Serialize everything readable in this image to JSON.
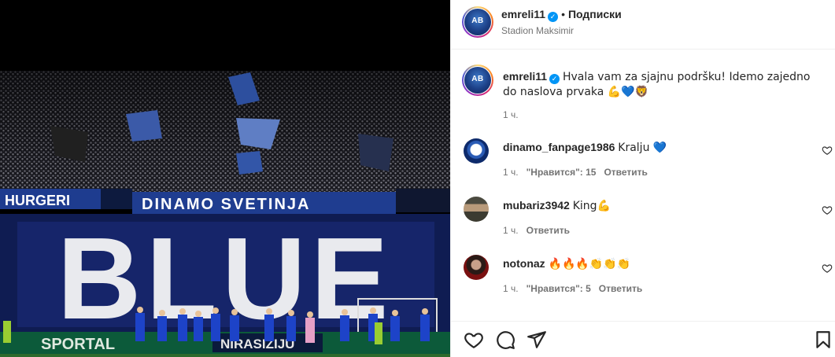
{
  "header": {
    "username": "emreli11",
    "separator": "•",
    "follow_label": "Подписки",
    "location": "Stadion Maksimir",
    "avatar_text": "AB"
  },
  "caption": {
    "username": "emreli11",
    "text": "Hvala vam za sjajnu podršku! Idemo zajedno do naslova prvaka 💪💙🦁",
    "time": "1 ч."
  },
  "comments": [
    {
      "username": "dinamo_fanpage1986",
      "text": "Kralju 💙",
      "time": "1 ч.",
      "likes": "\"Нравится\": 15",
      "reply": "Ответить"
    },
    {
      "username": "mubariz3942",
      "text": "King💪",
      "time": "1 ч.",
      "likes": "",
      "reply": "Ответить"
    },
    {
      "username": "notonaz",
      "text": "🔥🔥🔥👏👏👏",
      "time": "1 ч.",
      "likes": "\"Нравится\": 5",
      "reply": "Ответить"
    }
  ],
  "photo": {
    "banner_left": "HURGERI",
    "banner_main": "DINAMO SVETINJA",
    "tifo": "BLUE",
    "ad_left": "SPORTAL",
    "ad_right": "NIRASIZIJU"
  },
  "icons": [
    "like-icon",
    "comment-icon",
    "share-icon",
    "save-icon",
    "heart-icon",
    "verified-icon"
  ],
  "colors": {
    "verified": "#0095f6",
    "secondary_text": "#737373",
    "dinamo_blue": "#1c3f86"
  }
}
